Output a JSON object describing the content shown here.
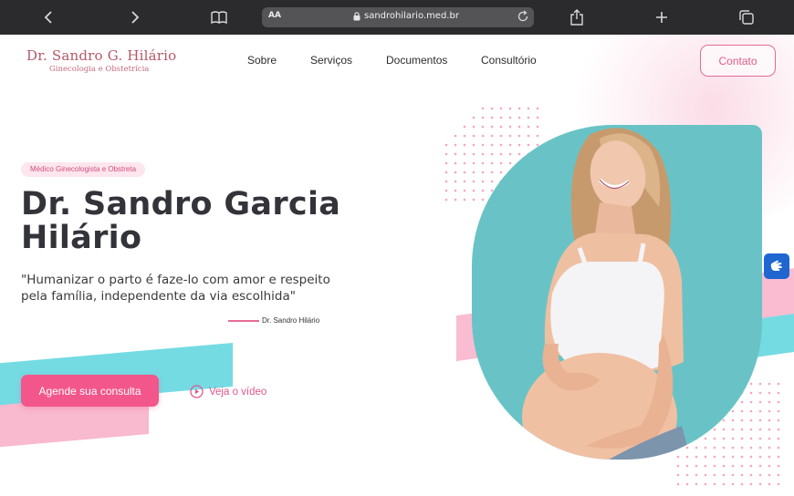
{
  "browser": {
    "aa_label": "AA",
    "url": "sandrohilario.med.br"
  },
  "header": {
    "logo_name": "Dr. Sandro G. Hilário",
    "logo_sub": "Ginecologia e Obstetrícia",
    "nav": [
      "Sobre",
      "Serviços",
      "Documentos",
      "Consultório"
    ],
    "contact_label": "Contato"
  },
  "hero": {
    "badge": "Médico Ginecologista e Obstreta",
    "title_line1": "Dr. Sandro Garcia",
    "title_line2": "Hilário",
    "quote_line1": "\"Humanizar o parto é faze-lo com amor e respeito",
    "quote_line2": "pela família, independente da via escolhida\"",
    "signature": "Dr. Sandro Hilário",
    "cta_label": "Agende sua consulta",
    "video_label": "Veja o vídeo"
  },
  "colors": {
    "accent_pink": "#f2568a",
    "logo": "#b45869",
    "teal": "#69c3c6",
    "cyan": "#74dbe3",
    "light_pink": "#f9b9cf",
    "browser_chrome": "#2b2b2d"
  },
  "icons": {
    "back": "chevron-left-icon",
    "forward": "chevron-right-icon",
    "bookmarks": "book-icon",
    "lock": "lock-icon",
    "reload": "reload-icon",
    "share": "share-icon",
    "new_tab": "plus-icon",
    "tabs": "tabs-icon",
    "play": "play-circle-icon",
    "accessibility": "sign-language-icon"
  }
}
